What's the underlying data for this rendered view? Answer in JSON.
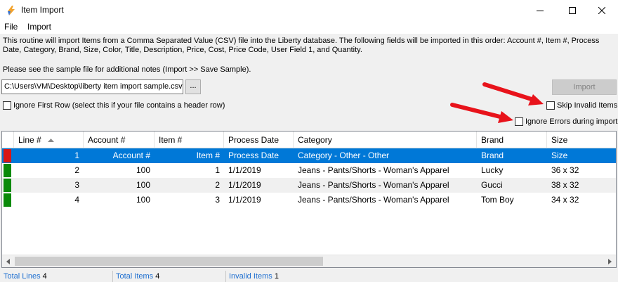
{
  "window": {
    "title": "Item Import",
    "app_icon": "lightning-app-icon",
    "controls": [
      "minimize-icon",
      "maximize-icon",
      "close-icon"
    ]
  },
  "menu": {
    "file": "File",
    "import": "Import"
  },
  "description": {
    "line1": "This routine will import Items from a Comma Separated Value (CSV) file into the Liberty database. The following fields will be imported in this order: Account #, Item #, Process Date, Category, Brand, Size, Color, Title, Description, Price, Cost, Price Code, User Field 1, and Quantity.",
    "line2": "Please see the sample file for additional notes (Import >> Save Sample)."
  },
  "file_path": {
    "value": "C:\\Users\\VM\\Desktop\\liberty item import sample.csv",
    "browse_label": "..."
  },
  "import_button": "Import",
  "options": {
    "ignore_first_row": "Ignore First Row (select this if your file contains a header row)",
    "skip_invalid": "Skip Invalid Items",
    "ignore_errors": "Ignore Errors during import"
  },
  "colors": {
    "selection": "#0078d7",
    "arrow": "#e8131b",
    "valid_indicator": "#0a8a0a",
    "invalid_indicator": "#d81616",
    "status_label": "#1e6fd0"
  },
  "grid": {
    "columns": [
      "Line #",
      "Account #",
      "Item #",
      "Process Date",
      "Category",
      "Brand",
      "Size"
    ],
    "rows": [
      {
        "status": "invalid",
        "line": "1",
        "account": "Account #",
        "item": "Item #",
        "date": "Process Date",
        "category": "Category - Other - Other",
        "brand": "Brand",
        "size": "Size"
      },
      {
        "status": "valid",
        "line": "2",
        "account": "100",
        "item": "1",
        "date": "1/1/2019",
        "category": "Jeans - Pants/Shorts - Woman's Apparel",
        "brand": "Lucky",
        "size": "36 x 32"
      },
      {
        "status": "valid",
        "line": "3",
        "account": "100",
        "item": "2",
        "date": "1/1/2019",
        "category": "Jeans - Pants/Shorts - Woman's Apparel",
        "brand": "Gucci",
        "size": "38 x 32"
      },
      {
        "status": "valid",
        "line": "4",
        "account": "100",
        "item": "3",
        "date": "1/1/2019",
        "category": "Jeans - Pants/Shorts - Woman's Apparel",
        "brand": "Tom Boy",
        "size": "34 x 32"
      }
    ]
  },
  "status_bar": {
    "total_lines_label": "Total Lines",
    "total_lines": "4",
    "total_items_label": "Total Items",
    "total_items": "4",
    "invalid_items_label": "Invalid Items",
    "invalid_items": "1"
  }
}
